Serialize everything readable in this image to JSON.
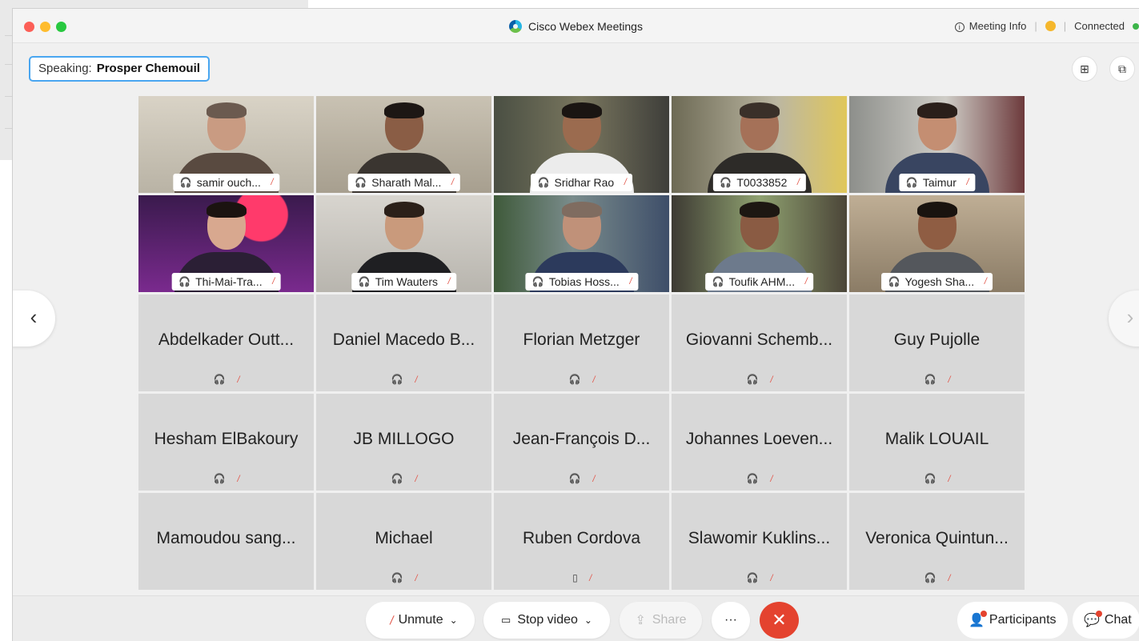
{
  "window": {
    "app_title": "Cisco Webex Meetings",
    "meeting_info": "Meeting Info",
    "connection_status": "Connected"
  },
  "speaking": {
    "label": "Speaking:",
    "name": "Prosper Chemouil"
  },
  "icons": {
    "headset": "headset-icon",
    "muted_mic": "muted-mic-icon",
    "phone": "phone-icon"
  },
  "video_tiles": [
    {
      "name": "samir ouch..."
    },
    {
      "name": "Sharath Mal..."
    },
    {
      "name": "Sridhar Rao"
    },
    {
      "name": "T0033852"
    },
    {
      "name": "Taimur"
    },
    {
      "name": "Thi-Mai-Tra..."
    },
    {
      "name": "Tim Wauters"
    },
    {
      "name": "Tobias Hoss..."
    },
    {
      "name": "Toufik AHM..."
    },
    {
      "name": "Yogesh Sha..."
    }
  ],
  "name_tiles": [
    {
      "name": "Abdelkader Outt...",
      "device": "headset"
    },
    {
      "name": "Daniel Macedo B...",
      "device": "headset"
    },
    {
      "name": "Florian Metzger",
      "device": "headset"
    },
    {
      "name": "Giovanni Schemb...",
      "device": "headset"
    },
    {
      "name": "Guy Pujolle",
      "device": "headset"
    },
    {
      "name": "Hesham ElBakoury",
      "device": "headset"
    },
    {
      "name": "JB MILLOGO",
      "device": "headset"
    },
    {
      "name": "Jean-François D...",
      "device": "headset"
    },
    {
      "name": "Johannes Loeven...",
      "device": "headset"
    },
    {
      "name": "Malik LOUAIL",
      "device": "headset"
    },
    {
      "name": "Mamoudou sang...",
      "device": "none"
    },
    {
      "name": "Michael",
      "device": "headset"
    },
    {
      "name": "Ruben Cordova",
      "device": "phone"
    },
    {
      "name": "Slawomir Kuklins...",
      "device": "headset"
    },
    {
      "name": "Veronica Quintun...",
      "device": "headset"
    }
  ],
  "toolbar": {
    "unmute": "Unmute",
    "stop_video": "Stop video",
    "share": "Share",
    "more": "···",
    "end": "✕",
    "participants": "Participants",
    "chat": "Chat"
  },
  "colors": {
    "accent_border": "#49a6f0",
    "end_button": "#e4432f",
    "mute_red": "#e2584c"
  }
}
